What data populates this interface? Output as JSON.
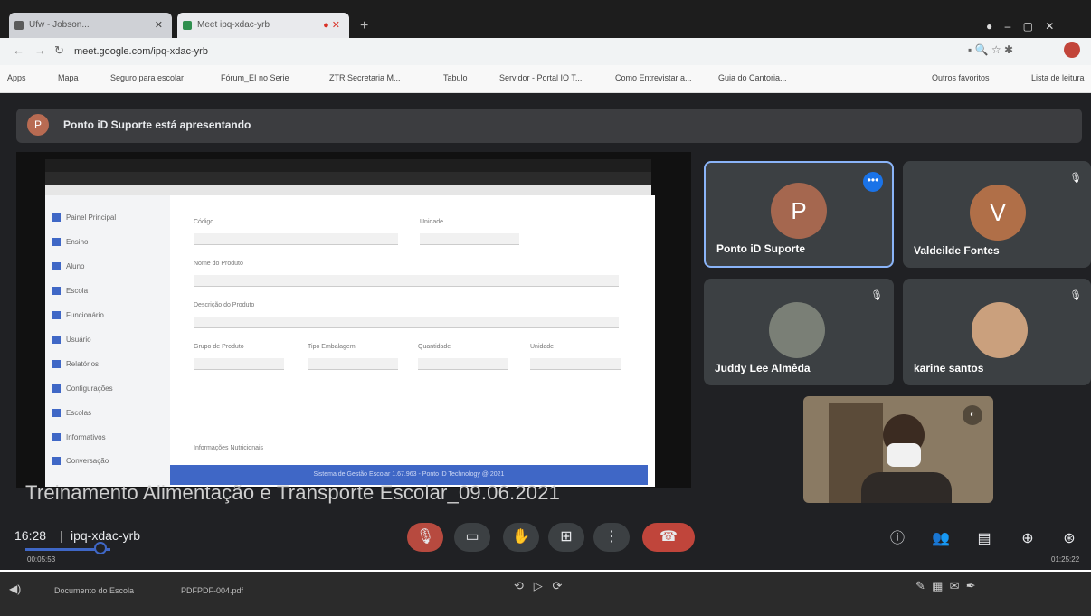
{
  "browser": {
    "tabs": [
      {
        "label": "Ufw - Jobson..."
      },
      {
        "label": "Meet ipq-xdac-yrb"
      }
    ],
    "url": "meet.google.com/ipq-xdac-yrb",
    "bookmarks": [
      "Apps",
      "Mapa",
      "Seguro para escolar",
      "Fórum_EI no Serie",
      "ZTR Secretaria M...",
      "Tabulo",
      "Servidor - Portal IO T...",
      "Como Entrevistar a...",
      "Guia do Cantoria...",
      "Outros favoritos",
      "Lista de leitura"
    ]
  },
  "meet": {
    "presenter_initial": "P",
    "presenter_banner": "Ponto iD Suporte está apresentando",
    "participants": [
      {
        "name": "Ponto iD Suporte",
        "initial": "P",
        "avatar_color": "#a5674f"
      },
      {
        "name": "Valdeilde Fontes",
        "initial": "V",
        "avatar_color": "#b06f48"
      },
      {
        "name": "Juddy Lee Almêda",
        "initial": ""
      },
      {
        "name": "karine santos",
        "initial": ""
      }
    ],
    "caption": "Treinamento Alimentação e Transporte Escolar_09.06.2021",
    "time": "16:28",
    "separator": "|",
    "meeting_code": "ipq-xdac-yrb",
    "elapsed": "00:05:53",
    "total": "01:25:22",
    "progress_fraction": 0.07
  },
  "shared_screen": {
    "menu": [
      "Painel Principal",
      "Ensino",
      "Aluno",
      "Escola",
      "Funcionário",
      "Usuário",
      "Relatórios",
      "Configurações",
      "Escolas",
      "Informativos",
      "Conversação"
    ],
    "fields": [
      "Código",
      "Unidade",
      "Nome do Produto",
      "Descrição do Produto",
      "Grupo de Produto",
      "Tipo Embalagem",
      "Quantidade",
      "Unidade",
      "Informações Nutricionais"
    ],
    "footer": "Sistema de Gestão Escolar 1.67.963 - Ponto iD Technology @ 2021"
  },
  "taskbar": {
    "items": [
      "Documento do Escola",
      "PDFPDF-004.pdf"
    ]
  },
  "colors": {
    "meet_bg": "#202124",
    "tile_bg": "#3c4043",
    "accent_blue": "#8ab4f8",
    "hangup_red": "#c0453b"
  }
}
